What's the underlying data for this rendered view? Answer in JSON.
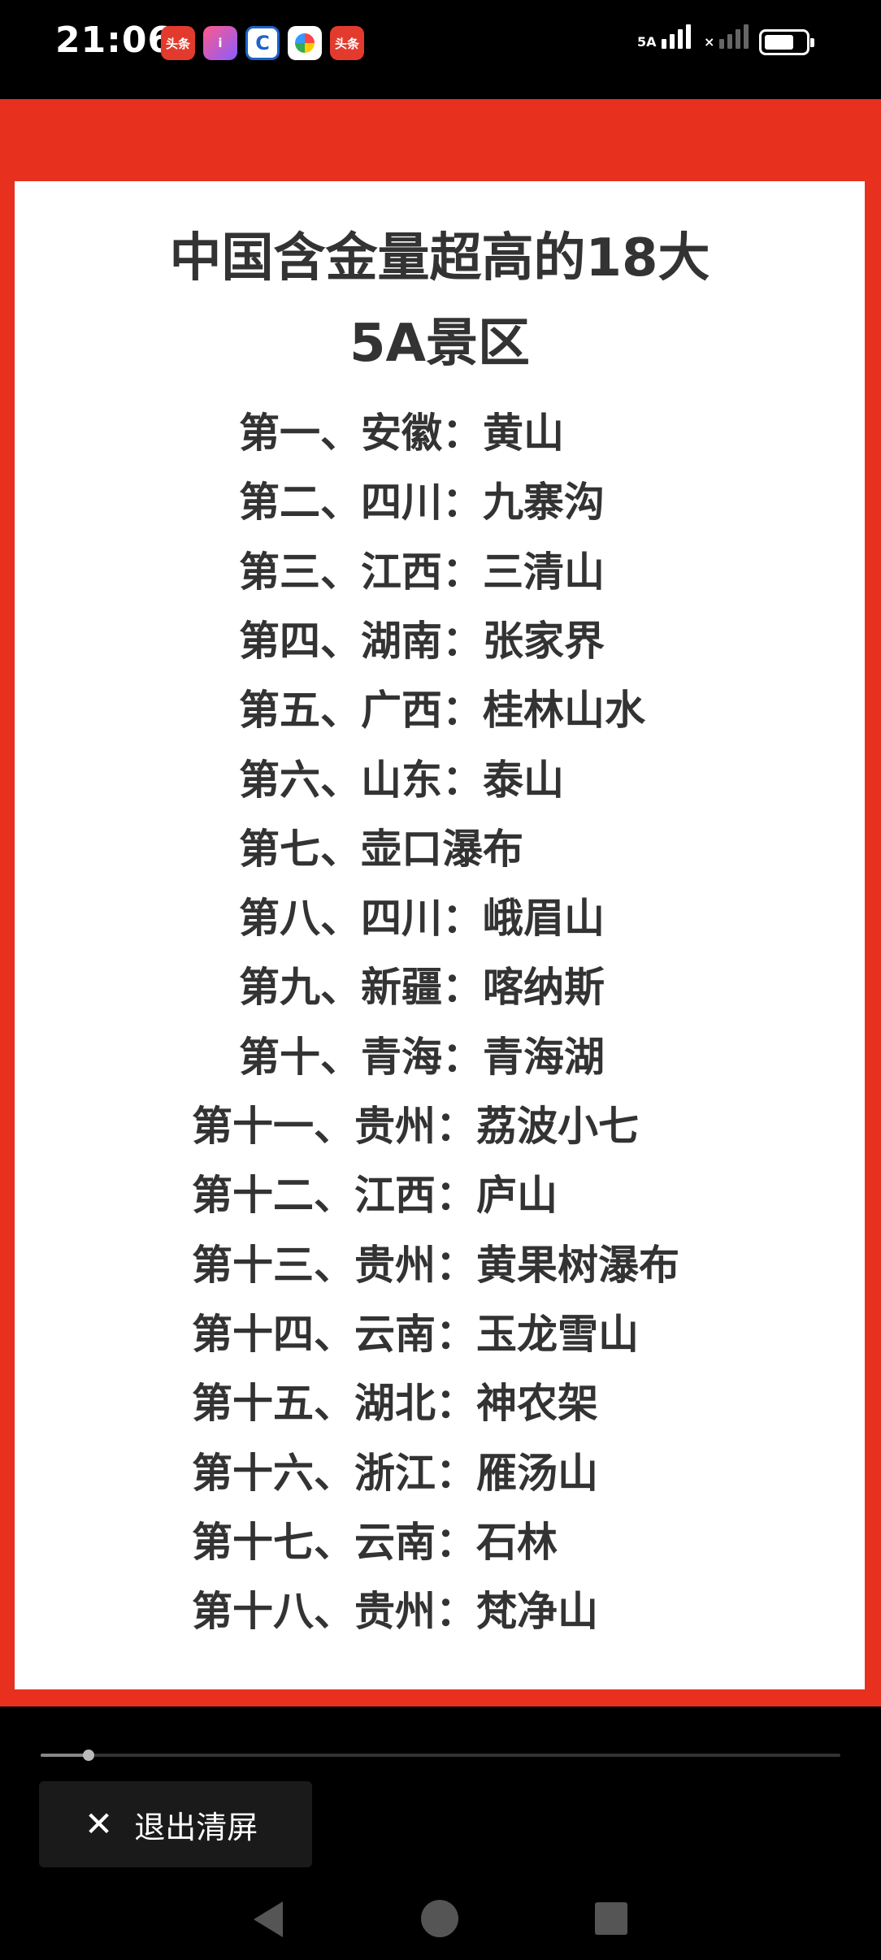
{
  "status_bar": {
    "time": "21:06",
    "app_icons": [
      {
        "name": "toutiao-icon",
        "label": "头条"
      },
      {
        "name": "idle-fish-icon",
        "label": "i"
      },
      {
        "name": "ccb-icon",
        "label": "C"
      },
      {
        "name": "map-icon",
        "label": ""
      },
      {
        "name": "toutiao-icon-2",
        "label": "头条"
      }
    ],
    "signal_1_label": "5A",
    "signal_2_label": "×",
    "battery_level": 0.8
  },
  "poster": {
    "title_line1": "中国含金量超高的18大",
    "title_line2": "5A景区",
    "items": [
      "第一、安徽：黄山",
      "第二、四川：九寨沟",
      "第三、江西：三清山",
      "第四、湖南：张家界",
      "第五、广西：桂林山水",
      "第六、山东：泰山",
      "第七、壶口瀑布",
      "第八、四川：峨眉山",
      "第九、新疆：喀纳斯",
      "第十、青海：青海湖",
      "第十一、贵州：荔波小七",
      "第十二、江西：庐山",
      "第十三、贵州：黄果树瀑布",
      "第十四、云南：玉龙雪山",
      "第十五、湖北：神农架",
      "第十六、浙江：雁汤山",
      "第十七、云南：石林",
      "第十八、贵州：梵净山"
    ]
  },
  "player": {
    "progress": 0.06
  },
  "exit_button": {
    "icon": "close-icon",
    "label": "退出清屏"
  },
  "nav_bar": {
    "back_icon": "back-icon",
    "home_icon": "home-icon",
    "recent_icon": "recent-apps-icon"
  },
  "colors": {
    "frame_red": "#e8301f",
    "text": "#333333",
    "background": "#000000"
  }
}
